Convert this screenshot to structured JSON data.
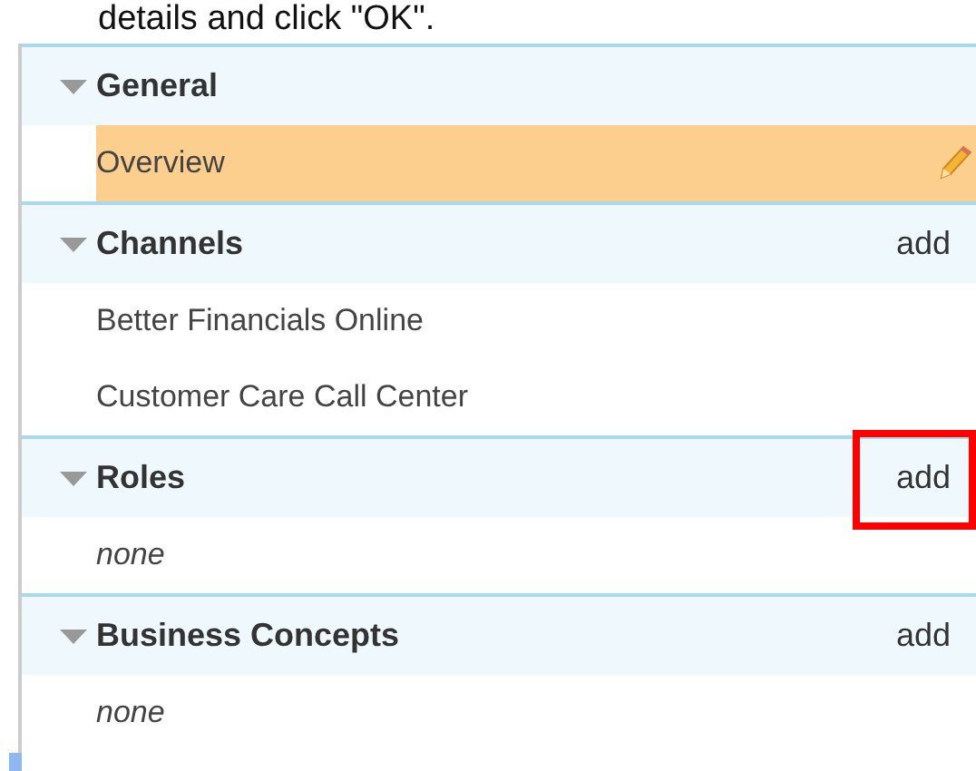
{
  "instruction": "details and click \"OK\".",
  "sections": [
    {
      "title": "General",
      "expanded": true,
      "items": [
        {
          "label": "Overview",
          "kind": "item",
          "selected": true,
          "editable": true
        }
      ]
    },
    {
      "title": "Channels",
      "expanded": true,
      "action": "add",
      "highlighted": false,
      "items": [
        {
          "label": "Better Financials Online",
          "kind": "item",
          "selected": false,
          "editable": false
        },
        {
          "label": "Customer Care Call Center",
          "kind": "item",
          "selected": false,
          "editable": false
        }
      ]
    },
    {
      "title": "Roles",
      "expanded": true,
      "action": "add",
      "highlighted": true,
      "items": [
        {
          "label": "none",
          "kind": "empty"
        }
      ]
    },
    {
      "title": "Business Concepts",
      "expanded": true,
      "action": "add",
      "highlighted": false,
      "items": [
        {
          "label": "none",
          "kind": "empty"
        }
      ]
    }
  ]
}
